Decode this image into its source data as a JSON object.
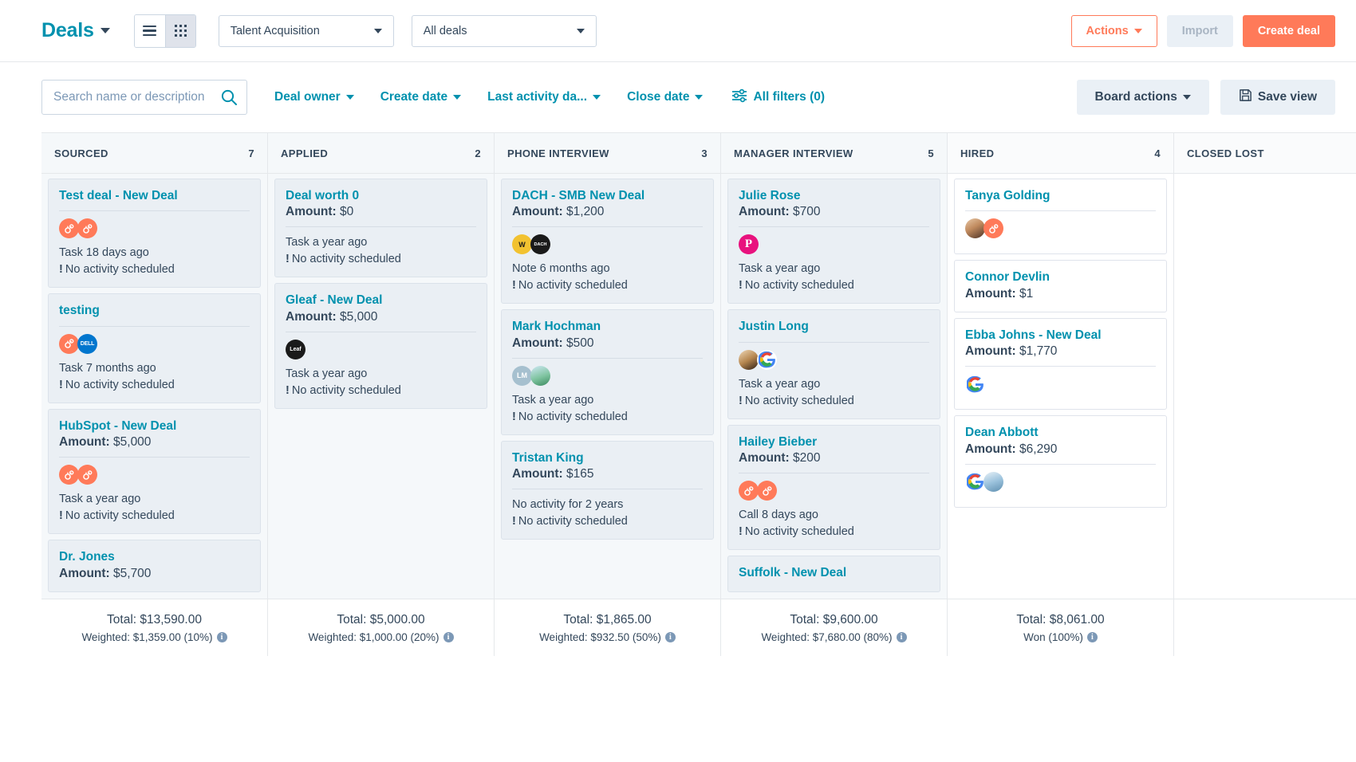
{
  "header": {
    "title": "Deals",
    "title_caret_icon": "chevron-down-icon",
    "view_list_icon": "list-view-icon",
    "view_board_icon": "board-view-icon",
    "pipeline_select": "Talent Acquisition",
    "view_select": "All deals",
    "actions_label": "Actions",
    "import_label": "Import",
    "create_label": "Create deal"
  },
  "filters": {
    "search_placeholder": "Search name or description",
    "search_value": "",
    "search_icon": "search-icon",
    "deal_owner": "Deal owner",
    "create_date": "Create date",
    "last_activity": "Last activity da...",
    "close_date": "Close date",
    "all_filters": "All filters (0)",
    "all_filters_icon": "filter-sliders-icon",
    "board_actions": "Board actions",
    "save_view": "Save view",
    "save_icon": "save-disk-icon"
  },
  "labels": {
    "amount_prefix": "Amount:",
    "no_activity": "No activity scheduled",
    "warn_icon": "exclamation-icon",
    "total_prefix": "Total:",
    "info_icon": "info-icon"
  },
  "columns": [
    {
      "name": "SOURCED",
      "count": "7",
      "highlight": true,
      "total": "Total: $13,590.00",
      "weighted": "Weighted: $1,359.00 (10%)",
      "cards": [
        {
          "title": "Test deal - New Deal",
          "amount": null,
          "avatars": [
            "hubspot",
            "hubspot"
          ],
          "activity": "Task 18 days ago",
          "no_activity": "No activity scheduled"
        },
        {
          "title": "testing",
          "amount": null,
          "avatars": [
            "hubspot",
            "dell"
          ],
          "activity": "Task 7 months ago",
          "no_activity": "No activity scheduled"
        },
        {
          "title": "HubSpot - New Deal",
          "amount": "$5,000",
          "avatars": [
            "hubspot",
            "hubspot"
          ],
          "activity": "Task a year ago",
          "no_activity": "No activity scheduled"
        },
        {
          "title": "Dr. Jones",
          "amount": "$5,700",
          "avatars": [],
          "activity": null,
          "no_activity": null
        }
      ]
    },
    {
      "name": "APPLIED",
      "count": "2",
      "highlight": true,
      "total": "Total: $5,000.00",
      "weighted": "Weighted: $1,000.00 (20%)",
      "cards": [
        {
          "title": "Deal worth 0",
          "amount": "$0",
          "avatars": [],
          "activity": "Task a year ago",
          "no_activity": "No activity scheduled"
        },
        {
          "title": "Gleaf - New Deal",
          "amount": "$5,000",
          "avatars": [
            "leaf"
          ],
          "activity": "Task a year ago",
          "no_activity": "No activity scheduled"
        }
      ]
    },
    {
      "name": "PHONE INTERVIEW",
      "count": "3",
      "highlight": true,
      "total": "Total: $1,865.00",
      "weighted": "Weighted: $932.50 (50%)",
      "cards": [
        {
          "title": "DACH - SMB New Deal",
          "amount": "$1,200",
          "avatars": [
            "yellow",
            "dark"
          ],
          "activity": "Note 6 months ago",
          "no_activity": "No activity scheduled"
        },
        {
          "title": "Mark Hochman",
          "amount": "$500",
          "avatars": [
            "lm",
            "photo-green"
          ],
          "activity": "Task a year ago",
          "no_activity": "No activity scheduled"
        },
        {
          "title": "Tristan King",
          "amount": "$165",
          "avatars": [],
          "activity": "No activity for 2 years",
          "no_activity": "No activity scheduled"
        }
      ]
    },
    {
      "name": "MANAGER INTERVIEW",
      "count": "5",
      "highlight": true,
      "total": "Total: $9,600.00",
      "weighted": "Weighted: $7,680.00 (80%)",
      "cards": [
        {
          "title": "Julie Rose",
          "amount": "$700",
          "avatars": [
            "pink"
          ],
          "activity": "Task a year ago",
          "no_activity": "No activity scheduled"
        },
        {
          "title": "Justin Long",
          "amount": null,
          "avatars": [
            "photo-blonde",
            "google"
          ],
          "activity": "Task a year ago",
          "no_activity": "No activity scheduled"
        },
        {
          "title": "Hailey Bieber",
          "amount": "$200",
          "avatars": [
            "hubspot",
            "hubspot"
          ],
          "activity": "Call 8 days ago",
          "no_activity": "No activity scheduled"
        },
        {
          "title": "Suffolk - New Deal",
          "amount": null,
          "avatars": [],
          "activity": null,
          "no_activity": null
        }
      ]
    },
    {
      "name": "HIRED",
      "count": "4",
      "highlight": false,
      "total": "Total: $8,061.00",
      "weighted": "Won (100%)",
      "cards": [
        {
          "title": "Tanya Golding",
          "amount": null,
          "avatars": [
            "photo-face",
            "hubspot"
          ],
          "activity": null,
          "no_activity": null
        },
        {
          "title": "Connor Devlin",
          "amount": "$1",
          "avatars": [],
          "activity": null,
          "no_activity": null
        },
        {
          "title": "Ebba Johns - New Deal",
          "amount": "$1,770",
          "avatars": [
            "google"
          ],
          "activity": null,
          "no_activity": null
        },
        {
          "title": "Dean Abbott",
          "amount": "$6,290",
          "avatars": [
            "google",
            "blue-photo"
          ],
          "activity": null,
          "no_activity": null
        }
      ]
    },
    {
      "name": "CLOSED LOST",
      "count": "",
      "highlight": false,
      "total": "",
      "weighted": "",
      "cards": []
    }
  ]
}
